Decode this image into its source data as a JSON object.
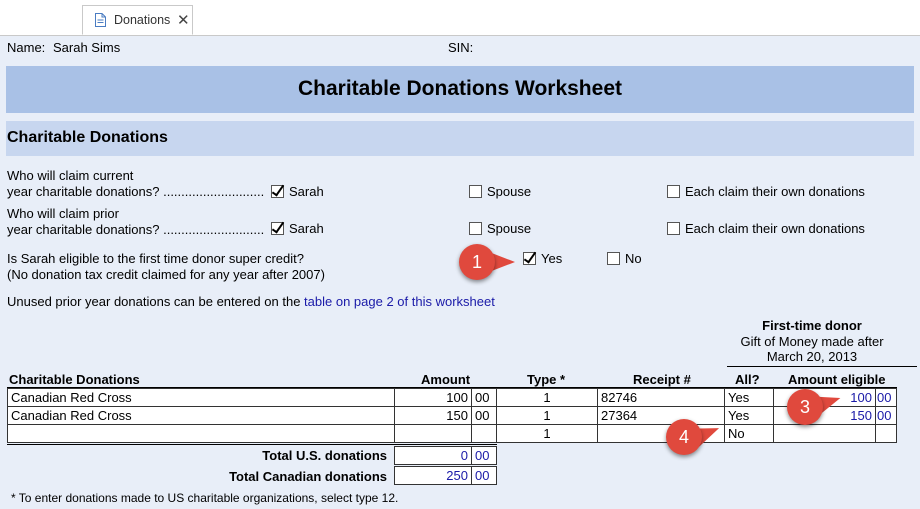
{
  "tab": {
    "label": "Donations",
    "icon": "document-icon"
  },
  "header": {
    "name_label": "Name:",
    "name_value": "Sarah Sims",
    "sin_label": "SIN:"
  },
  "title": "Charitable Donations Worksheet",
  "section_title": "Charitable Donations",
  "claim_current": {
    "line1": "Who will claim current",
    "line2": "year charitable donations? ............................",
    "options": [
      {
        "label": "Sarah",
        "checked": true
      },
      {
        "label": "Spouse",
        "checked": false
      },
      {
        "label": "Each claim their own donations",
        "checked": false
      }
    ]
  },
  "claim_prior": {
    "line1": "Who will claim prior",
    "line2": "year charitable donations? ............................",
    "options": [
      {
        "label": "Sarah",
        "checked": true
      },
      {
        "label": "Spouse",
        "checked": false
      },
      {
        "label": "Each claim their own donations",
        "checked": false
      }
    ]
  },
  "super_credit": {
    "line1": "Is Sarah eligible to the first time donor super credit?",
    "line2": "(No donation tax credit claimed for any year after 2007)",
    "yes_label": "Yes",
    "yes_checked": true,
    "no_label": "No",
    "no_checked": false
  },
  "unused_note": {
    "text": "Unused prior year donations can be entered on the",
    "link": "table on page 2 of this worksheet"
  },
  "first_time_header": {
    "line1": "First-time donor",
    "line2": "Gift of Money made after",
    "line3": "March 20, 2013"
  },
  "table": {
    "headers": {
      "donations": "Charitable Donations",
      "amount": "Amount",
      "type": "Type *",
      "receipt": "Receipt #",
      "all": "All?",
      "eligible": "Amount eligible"
    },
    "rows": [
      {
        "name": "Canadian Red Cross",
        "amount": "100",
        "amount_cents": "00",
        "type": "1",
        "receipt": "82746",
        "all": "Yes",
        "eligible": "100",
        "eligible_cents": "00"
      },
      {
        "name": "Canadian Red Cross",
        "amount": "150",
        "amount_cents": "00",
        "type": "1",
        "receipt": "27364",
        "all": "Yes",
        "eligible": "150",
        "eligible_cents": "00"
      },
      {
        "name": "",
        "amount": "",
        "amount_cents": "",
        "type": "1",
        "receipt": "",
        "all": "No",
        "eligible": "",
        "eligible_cents": ""
      }
    ],
    "totals": [
      {
        "label": "Total U.S. donations",
        "value": "0",
        "cents": "00"
      },
      {
        "label": "Total Canadian donations",
        "value": "250",
        "cents": "00"
      }
    ]
  },
  "footnote": "* To enter donations made to US charitable organizations, select type 12.",
  "callouts": [
    "1",
    "3",
    "4"
  ],
  "colors": {
    "title_bar": "#a9c1e6",
    "section_bar": "#c7d6ef",
    "sheet_bg": "#e8eef8",
    "callout": "#e0493d",
    "link": "#1a1aa8"
  }
}
